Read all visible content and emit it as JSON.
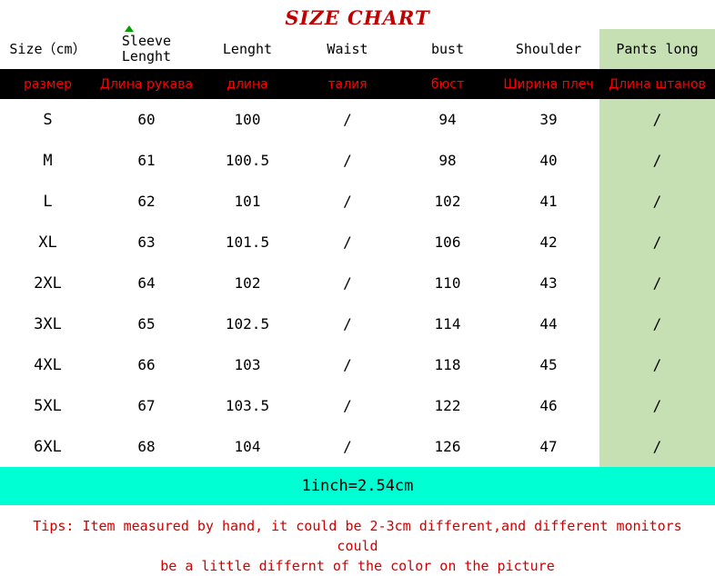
{
  "title": "SIZE CHART",
  "headers_en": [
    "Size（cm）",
    "Sleeve Lenght",
    "Lenght",
    "Waist",
    "bust",
    "Shoulder",
    "Pants long"
  ],
  "headers_ru": [
    "размер",
    "Длина рукава",
    "длина",
    "талия",
    "бюст",
    "Ширина плеч",
    "Длина штанов"
  ],
  "rows": [
    {
      "size": "S",
      "sleeve": "60",
      "length": "100",
      "waist": "/",
      "bust": "94",
      "shoulder": "39",
      "pants": "/"
    },
    {
      "size": "M",
      "sleeve": "61",
      "length": "100.5",
      "waist": "/",
      "bust": "98",
      "shoulder": "40",
      "pants": "/"
    },
    {
      "size": "L",
      "sleeve": "62",
      "length": "101",
      "waist": "/",
      "bust": "102",
      "shoulder": "41",
      "pants": "/"
    },
    {
      "size": "XL",
      "sleeve": "63",
      "length": "101.5",
      "waist": "/",
      "bust": "106",
      "shoulder": "42",
      "pants": "/"
    },
    {
      "size": "2XL",
      "sleeve": "64",
      "length": "102",
      "waist": "/",
      "bust": "110",
      "shoulder": "43",
      "pants": "/"
    },
    {
      "size": "3XL",
      "sleeve": "65",
      "length": "102.5",
      "waist": "/",
      "bust": "114",
      "shoulder": "44",
      "pants": "/"
    },
    {
      "size": "4XL",
      "sleeve": "66",
      "length": "103",
      "waist": "/",
      "bust": "118",
      "shoulder": "45",
      "pants": "/"
    },
    {
      "size": "5XL",
      "sleeve": "67",
      "length": "103.5",
      "waist": "/",
      "bust": "122",
      "shoulder": "46",
      "pants": "/"
    },
    {
      "size": "6XL",
      "sleeve": "68",
      "length": "104",
      "waist": "/",
      "bust": "126",
      "shoulder": "47",
      "pants": "/"
    }
  ],
  "inch_note": "1inch=2.54cm",
  "tips_line1": "Tips: Item measured by hand, it could be 2-3cm different,and different monitors could",
  "tips_line2": "be a little differnt of the color on the picture",
  "colors": {
    "title": "#c00000",
    "header_bar": "#000000",
    "header_text": "#ff0000",
    "green_column": "#c6e0b4",
    "inch_band": "#00ffd2",
    "tips": "#d00000"
  }
}
